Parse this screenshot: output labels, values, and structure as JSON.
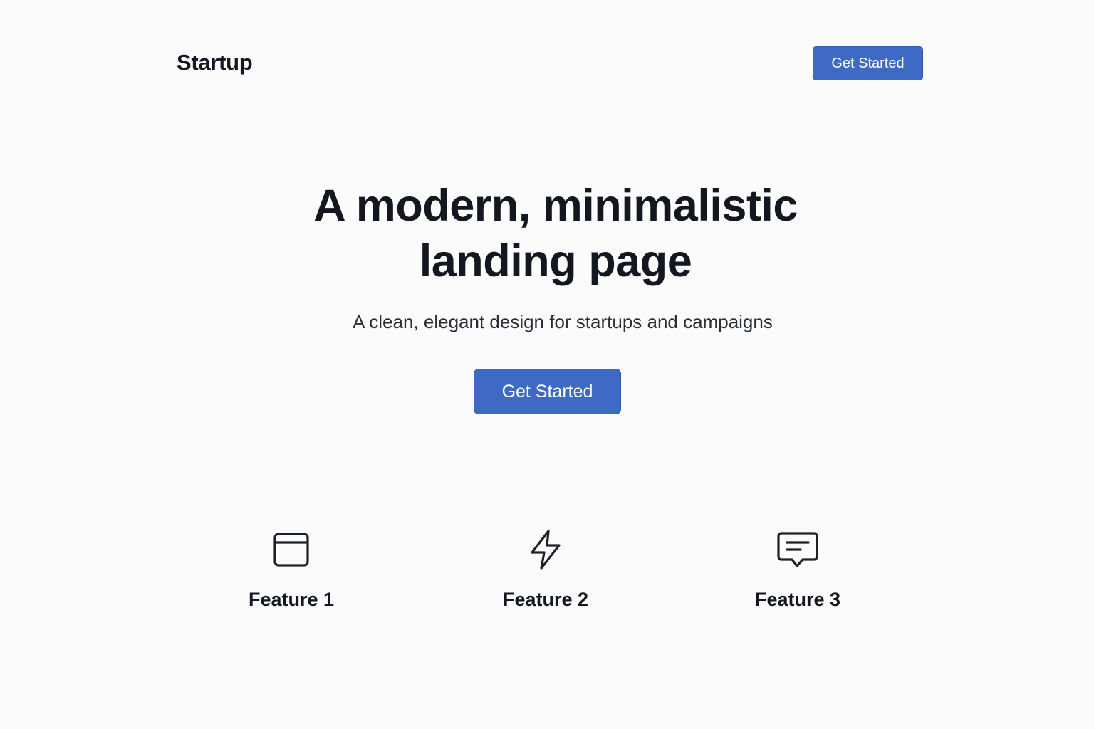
{
  "header": {
    "brand": "Startup",
    "cta_label": "Get Started"
  },
  "hero": {
    "title": "A modern, minimalistic landing page",
    "subtitle": "A clean, elegant design for startups and campaigns",
    "cta_label": "Get Started"
  },
  "features": [
    {
      "label": "Feature 1",
      "icon": "browser-window-icon"
    },
    {
      "label": "Feature 2",
      "icon": "lightning-bolt-icon"
    },
    {
      "label": "Feature 3",
      "icon": "chat-message-icon"
    }
  ],
  "colors": {
    "accent": "#3e6ac6",
    "background": "#fbfbfb",
    "text": "#14171f"
  }
}
